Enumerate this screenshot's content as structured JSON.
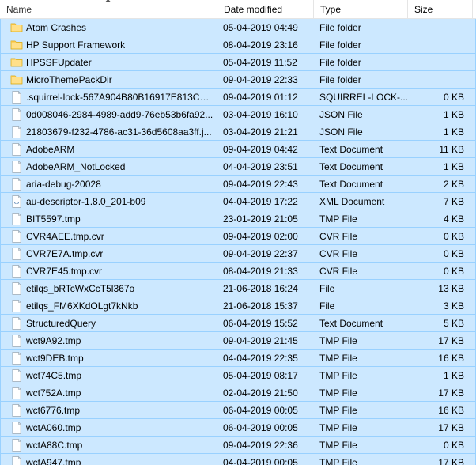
{
  "columns": {
    "name": "Name",
    "date": "Date modified",
    "type": "Type",
    "size": "Size"
  },
  "sort": {
    "column": "name",
    "direction": "asc"
  },
  "rows": [
    {
      "icon": "folder",
      "name": "Atom Crashes",
      "date": "05-04-2019 04:49",
      "type": "File folder",
      "size": ""
    },
    {
      "icon": "folder",
      "name": "HP Support Framework",
      "date": "08-04-2019 23:16",
      "type": "File folder",
      "size": ""
    },
    {
      "icon": "folder",
      "name": "HPSSFUpdater",
      "date": "05-04-2019 11:52",
      "type": "File folder",
      "size": ""
    },
    {
      "icon": "folder",
      "name": "MicroThemePackDir",
      "date": "09-04-2019 22:33",
      "type": "File folder",
      "size": ""
    },
    {
      "icon": "file",
      "name": ".squirrel-lock-567A904B80B16917E813CC...",
      "date": "09-04-2019 01:12",
      "type": "SQUIRREL-LOCK-...",
      "size": "0 KB"
    },
    {
      "icon": "file",
      "name": "0d008046-2984-4989-add9-76eb53b6fa92...",
      "date": "03-04-2019 16:10",
      "type": "JSON File",
      "size": "1 KB"
    },
    {
      "icon": "file",
      "name": "21803679-f232-4786-ac31-36d5608aa3ff.j...",
      "date": "03-04-2019 21:21",
      "type": "JSON File",
      "size": "1 KB"
    },
    {
      "icon": "file",
      "name": "AdobeARM",
      "date": "09-04-2019 04:42",
      "type": "Text Document",
      "size": "11 KB"
    },
    {
      "icon": "file",
      "name": "AdobeARM_NotLocked",
      "date": "04-04-2019 23:51",
      "type": "Text Document",
      "size": "1 KB"
    },
    {
      "icon": "file",
      "name": "aria-debug-20028",
      "date": "09-04-2019 22:43",
      "type": "Text Document",
      "size": "2 KB"
    },
    {
      "icon": "xml",
      "name": "au-descriptor-1.8.0_201-b09",
      "date": "04-04-2019 17:22",
      "type": "XML Document",
      "size": "7 KB"
    },
    {
      "icon": "file",
      "name": "BIT5597.tmp",
      "date": "23-01-2019 21:05",
      "type": "TMP File",
      "size": "4 KB"
    },
    {
      "icon": "file",
      "name": "CVR4AEE.tmp.cvr",
      "date": "09-04-2019 02:00",
      "type": "CVR File",
      "size": "0 KB"
    },
    {
      "icon": "file",
      "name": "CVR7E7A.tmp.cvr",
      "date": "09-04-2019 22:37",
      "type": "CVR File",
      "size": "0 KB"
    },
    {
      "icon": "file",
      "name": "CVR7E45.tmp.cvr",
      "date": "08-04-2019 21:33",
      "type": "CVR File",
      "size": "0 KB"
    },
    {
      "icon": "file",
      "name": "etilqs_bRTcWxCcT5l367o",
      "date": "21-06-2018 16:24",
      "type": "File",
      "size": "13 KB"
    },
    {
      "icon": "file",
      "name": "etilqs_FM6XKdOLgt7kNkb",
      "date": "21-06-2018 15:37",
      "type": "File",
      "size": "3 KB"
    },
    {
      "icon": "file",
      "name": "StructuredQuery",
      "date": "06-04-2019 15:52",
      "type": "Text Document",
      "size": "5 KB"
    },
    {
      "icon": "file",
      "name": "wct9A92.tmp",
      "date": "09-04-2019 21:45",
      "type": "TMP File",
      "size": "17 KB"
    },
    {
      "icon": "file",
      "name": "wct9DEB.tmp",
      "date": "04-04-2019 22:35",
      "type": "TMP File",
      "size": "16 KB"
    },
    {
      "icon": "file",
      "name": "wct74C5.tmp",
      "date": "05-04-2019 08:17",
      "type": "TMP File",
      "size": "1 KB"
    },
    {
      "icon": "file",
      "name": "wct752A.tmp",
      "date": "02-04-2019 21:50",
      "type": "TMP File",
      "size": "17 KB"
    },
    {
      "icon": "file",
      "name": "wct6776.tmp",
      "date": "06-04-2019 00:05",
      "type": "TMP File",
      "size": "16 KB"
    },
    {
      "icon": "file",
      "name": "wctA060.tmp",
      "date": "06-04-2019 00:05",
      "type": "TMP File",
      "size": "17 KB"
    },
    {
      "icon": "file",
      "name": "wctA88C.tmp",
      "date": "09-04-2019 22:36",
      "type": "TMP File",
      "size": "0 KB"
    },
    {
      "icon": "file",
      "name": "wctA947.tmp",
      "date": "04-04-2019 00:05",
      "type": "TMP File",
      "size": "17 KB"
    }
  ]
}
